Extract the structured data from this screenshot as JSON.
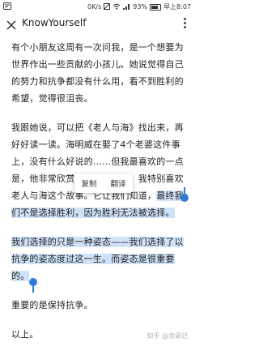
{
  "status": {
    "network": "0K/s",
    "battery": "93%",
    "time": "早上8:07"
  },
  "nav": {
    "title": "KnowYourself"
  },
  "article": {
    "p1": "有个小朋友这周有一次问我，是一个想要为世界作出一些贡献的小孩儿。她说觉得自己的努力和抗争都没有什么用，看不到胜利的希望，觉得很沮丧。",
    "p2_before": "我跟她说，可以把《老人与海》找出来，再好好读一读。海明威在娶了4个老婆这件事上，没有什么好说的……但我最喜欢的一点是，他非常欣赏意志坚强的人，我特别喜欢老人与海这个故事。它让我们知道，",
    "p2_highlight": "最终我们不是选择胜利，因为胜利无法被选择。",
    "p3_highlight": "我们选择的只是一种姿态——我们选择了以抗争的姿态度过这一生。而姿态是很重要的。",
    "p4": "重要的是保持抗争。",
    "p5": "以上。"
  },
  "popup": {
    "copy": "复制",
    "translate": "翻译"
  },
  "watermark": "知乎 @余哥记"
}
